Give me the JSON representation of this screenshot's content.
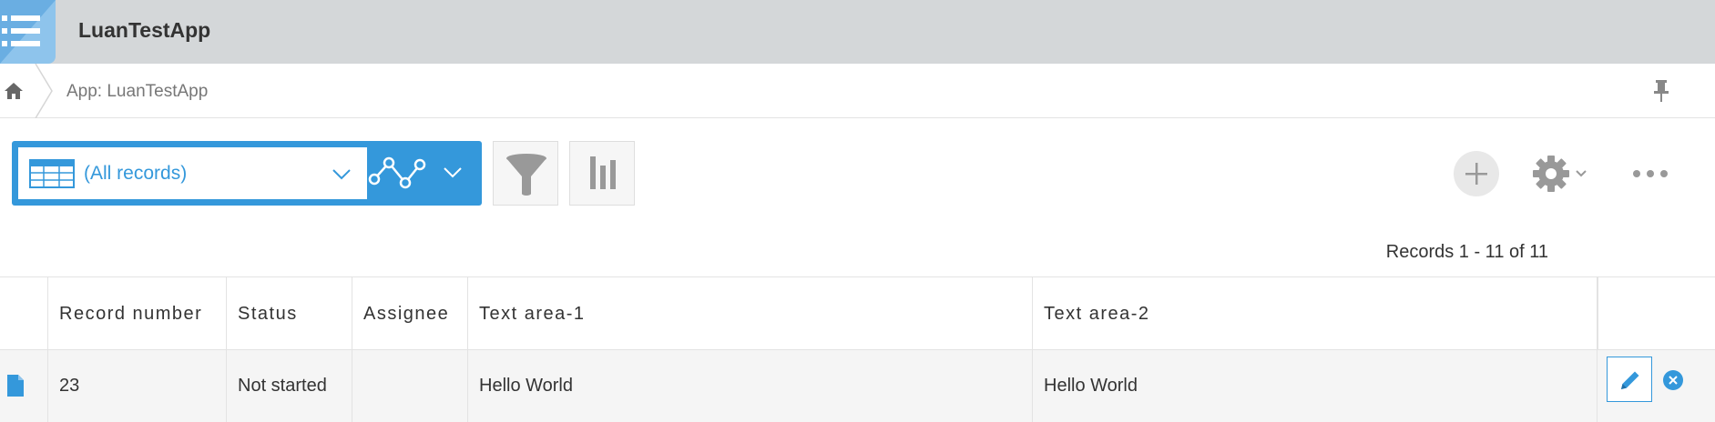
{
  "app": {
    "title": "LuanTestApp"
  },
  "breadcrumb": {
    "current": "App: LuanTestApp"
  },
  "toolbar": {
    "view_label": "(All records)"
  },
  "records": {
    "count_label": "Records 1 - 11 of 11"
  },
  "table": {
    "columns": [
      "Record number",
      "Status",
      "Assignee",
      "Text area-1",
      "Text area-2"
    ],
    "rows": [
      {
        "record_number": "23",
        "status": "Not started",
        "assignee": "",
        "text_area_1": "Hello World",
        "text_area_2": "Hello World"
      }
    ]
  },
  "colors": {
    "accent": "#3498db",
    "header_bg": "#d4d7d9",
    "row_bg": "#f5f5f5"
  },
  "icons": [
    "app-list-icon",
    "home-icon",
    "pin-icon",
    "table-view-icon",
    "chevron-down-icon",
    "graph-icon",
    "filter-icon",
    "bar-chart-icon",
    "plus-icon",
    "gear-icon",
    "more-icon",
    "record-file-icon",
    "pencil-icon",
    "close-icon"
  ]
}
